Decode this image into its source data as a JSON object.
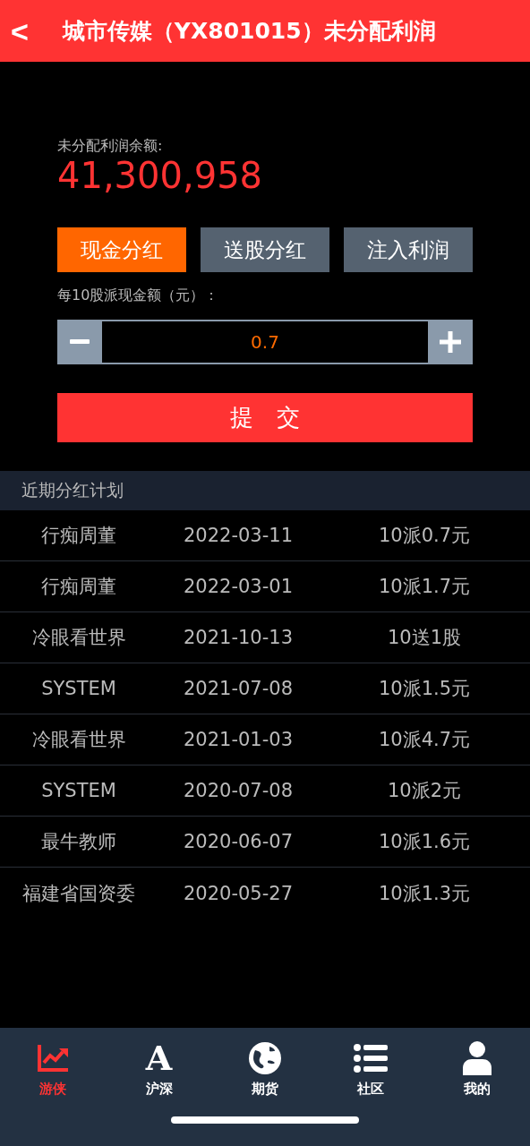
{
  "header": {
    "back": "<",
    "title": "城市传媒（YX801015）未分配利润"
  },
  "balance": {
    "label": "未分配利润余额:",
    "amount": "41,300,958"
  },
  "modes": [
    {
      "label": "现金分红",
      "selected": true
    },
    {
      "label": "送股分红",
      "selected": false
    },
    {
      "label": "注入利润",
      "selected": false
    }
  ],
  "amount_field": {
    "label": "每10股派现金额（元）：",
    "value": "0.7"
  },
  "submit": "提　交",
  "plans": {
    "title": "近期分红计划",
    "rows": [
      {
        "name": "行痴周董",
        "date": "2022-03-11",
        "plan": "10派0.7元"
      },
      {
        "name": "行痴周董",
        "date": "2022-03-01",
        "plan": "10派1.7元"
      },
      {
        "name": "冷眼看世界",
        "date": "2021-10-13",
        "plan": "10送1股"
      },
      {
        "name": "SYSTEM",
        "date": "2021-07-08",
        "plan": "10派1.5元"
      },
      {
        "name": "冷眼看世界",
        "date": "2021-01-03",
        "plan": "10派4.7元"
      },
      {
        "name": "SYSTEM",
        "date": "2020-07-08",
        "plan": "10派2元"
      },
      {
        "name": "最牛教师",
        "date": "2020-06-07",
        "plan": "10派1.6元"
      },
      {
        "name": "福建省国资委",
        "date": "2020-05-27",
        "plan": "10派1.3元"
      }
    ]
  },
  "tabs": [
    {
      "kind": "chart",
      "label": "游侠",
      "selected": true
    },
    {
      "kind": "letter",
      "icon_text": "A",
      "label": "沪深",
      "selected": false
    },
    {
      "kind": "globe",
      "label": "期货",
      "selected": false
    },
    {
      "kind": "list",
      "label": "社区",
      "selected": false
    },
    {
      "kind": "person",
      "label": "我的",
      "selected": false
    }
  ]
}
